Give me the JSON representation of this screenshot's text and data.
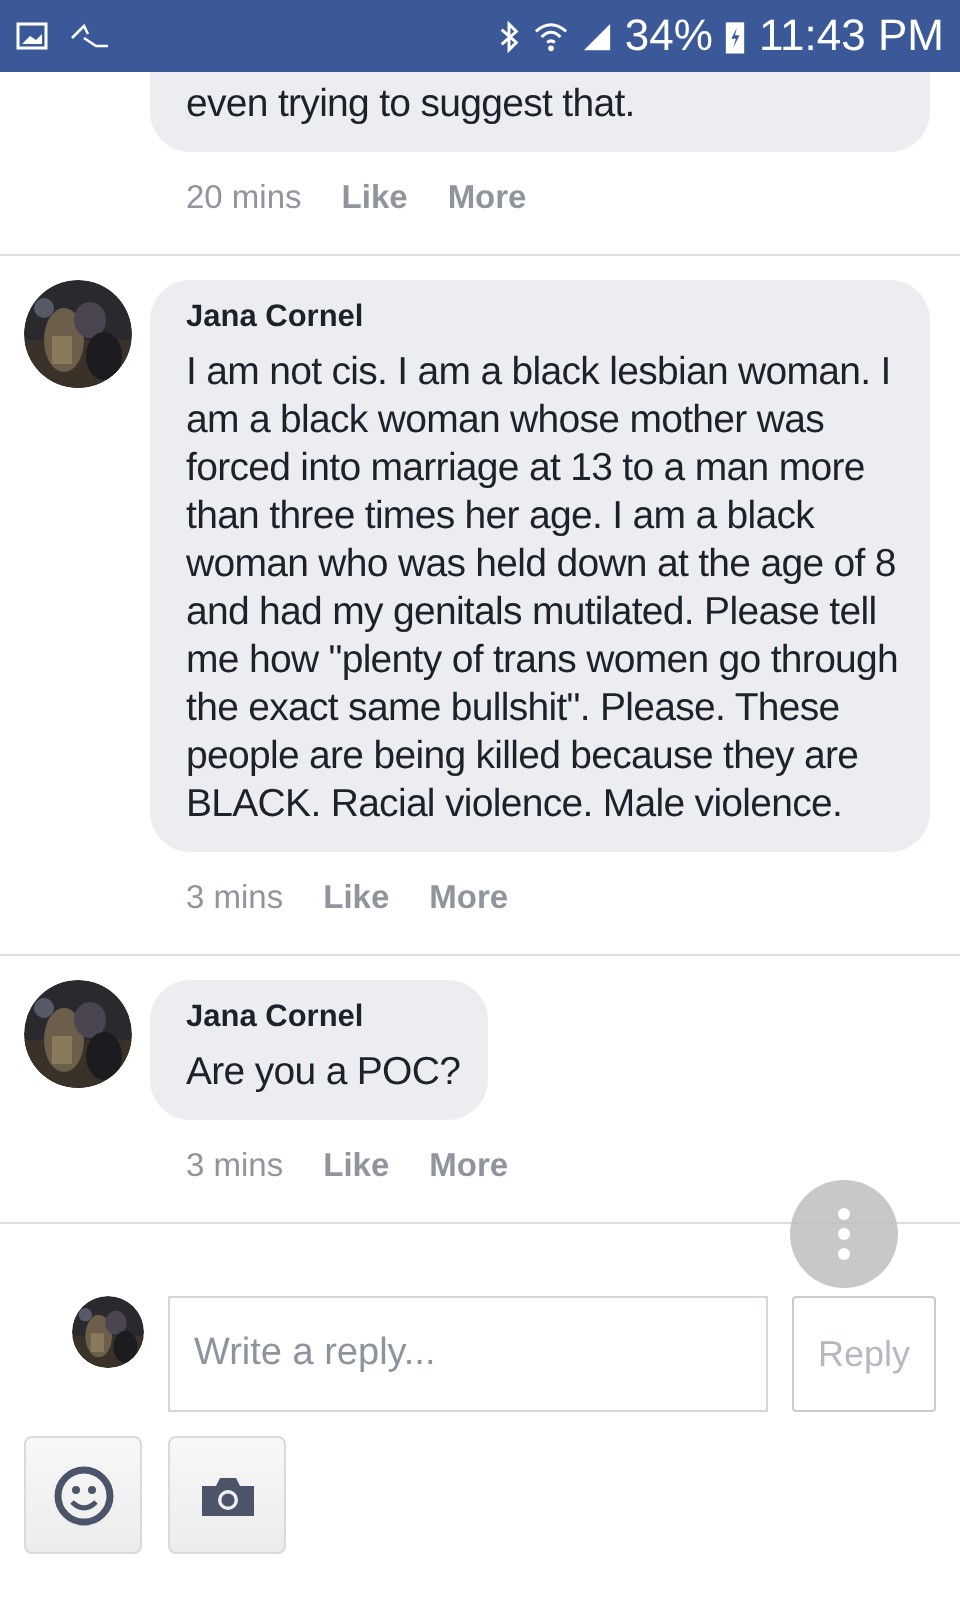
{
  "status_bar": {
    "battery": "34%",
    "time": "11:43 PM"
  },
  "comments": [
    {
      "text": "even trying to suggest that.",
      "time": "20 mins",
      "actions": [
        "Like",
        "More"
      ]
    },
    {
      "author": "Jana Cornel",
      "text": "I am not cis. I am a black lesbian woman. I am a black woman whose mother was forced into marriage at 13 to a man more than three times her age. I am a black woman who was held down at the age of 8 and had my genitals mutilated. Please tell me how \"plenty of trans women go through the exact same bullshit\". Please. These people are being killed because they are BLACK. Racial violence. Male violence.",
      "time": "3 mins",
      "actions": [
        "Like",
        "More"
      ]
    },
    {
      "author": "Jana Cornel",
      "text": "Are you a POC?",
      "time": "3 mins",
      "actions": [
        "Like",
        "More"
      ]
    }
  ],
  "composer": {
    "placeholder": "Write a reply...",
    "submit": "Reply",
    "submit_disabled": true
  }
}
